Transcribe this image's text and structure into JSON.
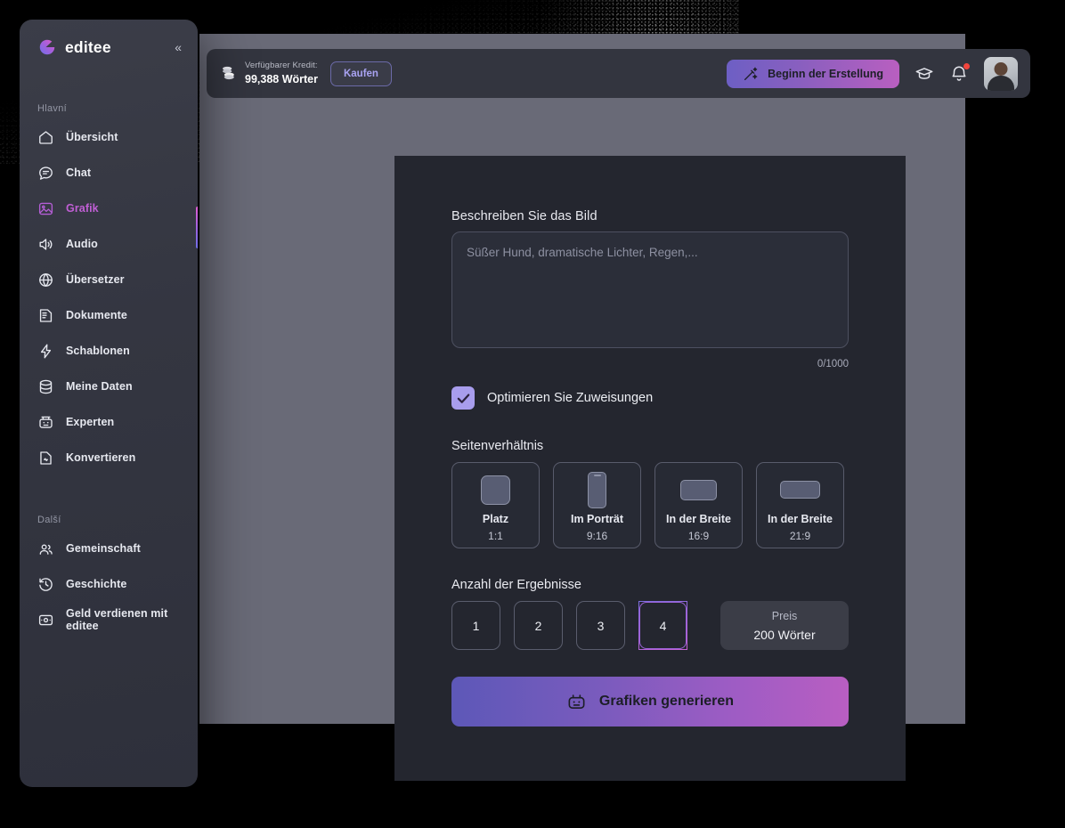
{
  "sidebar": {
    "logo_text": "editee",
    "collapse_icon": "double-chevron-left-icon",
    "groups": [
      {
        "label": "Hlavní",
        "items": [
          {
            "label": "Übersicht",
            "icon": "home-icon",
            "active": false
          },
          {
            "label": "Chat",
            "icon": "chat-bubble-icon",
            "active": false
          },
          {
            "label": "Grafik",
            "icon": "image-icon",
            "active": true
          },
          {
            "label": "Audio",
            "icon": "speaker-icon",
            "active": false
          },
          {
            "label": "Übersetzer",
            "icon": "globe-icon",
            "active": false
          },
          {
            "label": "Dokumente",
            "icon": "document-icon",
            "active": false
          },
          {
            "label": "Schablonen",
            "icon": "lightning-icon",
            "active": false
          },
          {
            "label": "Meine Daten",
            "icon": "database-icon",
            "active": false
          },
          {
            "label": "Experten",
            "icon": "robot-icon",
            "active": false
          },
          {
            "label": "Konvertieren",
            "icon": "file-convert-icon",
            "active": false
          }
        ]
      },
      {
        "label": "Další",
        "items": [
          {
            "label": "Gemeinschaft",
            "icon": "users-icon",
            "active": false
          },
          {
            "label": "Geschichte",
            "icon": "history-icon",
            "active": false
          },
          {
            "label": "Geld verdienen mit editee",
            "icon": "money-box-icon",
            "active": false
          }
        ]
      }
    ]
  },
  "topbar": {
    "coin_icon": "coins-icon",
    "credit_label": "Verfügbarer Kredit:",
    "credit_value": "99,388 Wörter",
    "buy_label": "Kaufen",
    "create_label": "Beginn der Erstellung",
    "create_icon": "magic-wand-icon",
    "academy_icon": "graduation-cap-icon",
    "bell_icon": "bell-icon",
    "avatar_icon": "user-avatar"
  },
  "main": {
    "prompt": {
      "label": "Beschreiben Sie das Bild",
      "placeholder": "Süßer Hund, dramatische Lichter, Regen,...",
      "value": "",
      "char_count": "0/1000"
    },
    "optimize": {
      "label": "Optimieren Sie Zuweisungen",
      "checked": true,
      "check_icon": "checkmark-icon"
    },
    "aspect_ratio": {
      "title": "Seitenverhältnis",
      "options": [
        {
          "name": "Platz",
          "value": "1:1",
          "shape": "square",
          "selected": false
        },
        {
          "name": "Im Porträt",
          "value": "9:16",
          "shape": "portrait",
          "selected": false
        },
        {
          "name": "In der Breite",
          "value": "16:9",
          "shape": "wide169",
          "selected": false
        },
        {
          "name": "In der Breite",
          "value": "21:9",
          "shape": "wide219",
          "selected": false
        }
      ]
    },
    "results": {
      "title": "Anzahl der Ergebnisse",
      "options": [
        "1",
        "2",
        "3",
        "4"
      ],
      "selected": "4",
      "price_label": "Preis",
      "price_value": "200 Wörter"
    },
    "generate": {
      "label": "Grafiken generieren",
      "icon": "robot-face-icon"
    }
  },
  "colors": {
    "accent_purple": "#a05fd0",
    "accent_pink": "#c05fd5",
    "checkbox": "#a89ded",
    "panel_bg": "#24262f",
    "sidebar_bg": "#343641",
    "backdrop": "#696a77",
    "topbar_bg": "#33353f",
    "notification_dot": "#f2453d"
  }
}
